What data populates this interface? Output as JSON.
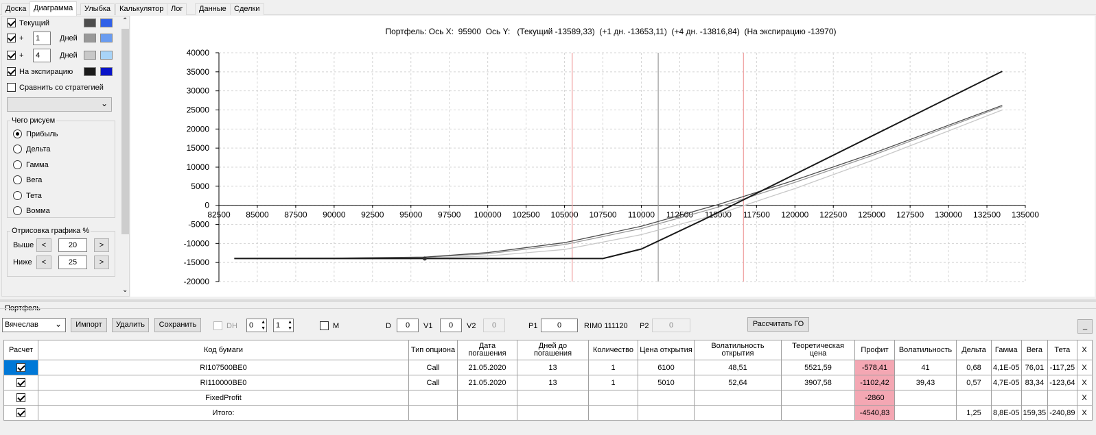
{
  "tabs": [
    "Доска",
    "Диаграмма",
    "Улыбка",
    "Калькулятор",
    "Лог",
    "Данные",
    "Сделки"
  ],
  "active_tab": "Диаграмма",
  "left": {
    "series": [
      {
        "checked": true,
        "prefix": "",
        "days": "",
        "label": "Текущий",
        "colors": [
          "#4d4d4d",
          "#3060e8"
        ]
      },
      {
        "checked": true,
        "prefix": "+",
        "days": "1",
        "label": "Дней",
        "colors": [
          "#999999",
          "#6a9cf0"
        ]
      },
      {
        "checked": true,
        "prefix": "+",
        "days": "4",
        "label": "Дней",
        "colors": [
          "#c8c8c8",
          "#a8d4f8"
        ]
      },
      {
        "checked": true,
        "prefix": "",
        "days": "",
        "label": "На экспирацию",
        "colors": [
          "#1a1a1a",
          "#0a14c8"
        ]
      }
    ],
    "compare_label": "Сравнить со стратегией",
    "compare_checked": false,
    "what_group_title": "Чего рисуем",
    "radios": [
      "Прибыль",
      "Дельта",
      "Гамма",
      "Вега",
      "Тета",
      "Вомма"
    ],
    "radio_selected": "Прибыль",
    "draw_group_title": "Отрисовка графика %",
    "above_label": "Выше",
    "above_value": "20",
    "below_label": "Ниже",
    "below_value": "25"
  },
  "chart": {
    "title": "Портфель: Ось X:  95900  Ось Y:   (Текущий -13589,33)  (+1 дн. -13653,11)  (+4 дн. -13816,84)  (На экспирацию -13970)"
  },
  "chart_data": {
    "type": "line",
    "title": "Портфель: Ось X:  95900  Ось Y:   (Текущий -13589,33)  (+1 дн. -13653,11)  (+4 дн. -13816,84)  (На экспирацию -13970)",
    "xlim": [
      82500,
      135000
    ],
    "ylim": [
      -20000,
      40000
    ],
    "x_ticks": [
      "82500",
      "85000",
      "87500",
      "90000",
      "92500",
      "95000",
      "97500",
      "100000",
      "102500",
      "105000",
      "107500",
      "110000",
      "112500",
      "115000",
      "117500",
      "120000",
      "122500",
      "125000",
      "127500",
      "130000",
      "132500",
      "135000"
    ],
    "y_ticks": [
      "40000",
      "35000",
      "30000",
      "25000",
      "20000",
      "15000",
      "10000",
      "5000",
      "0",
      "-5000",
      "-10000",
      "-15000",
      "-20000"
    ],
    "grid": true,
    "vlines": [
      {
        "x": 105500,
        "color": "#f0a0a0"
      },
      {
        "x": 111100,
        "color": "#999999"
      },
      {
        "x": 116650,
        "color": "#f0a0a0"
      }
    ],
    "marker": {
      "x": 95900,
      "y": -13970
    },
    "series": [
      {
        "name": "Текущий",
        "color": "#4d4d4d",
        "x": [
          83500,
          90000,
          95900,
          100000,
          105000,
          110000,
          115000,
          120000,
          125000,
          130000,
          133500
        ],
        "y": [
          -13900,
          -13850,
          -13589,
          -12400,
          -9800,
          -5500,
          200,
          6600,
          13500,
          21000,
          26200
        ]
      },
      {
        "name": "+1 дн.",
        "color": "#999999",
        "x": [
          83500,
          90000,
          95900,
          100000,
          105000,
          110000,
          115000,
          120000,
          125000,
          130000,
          133500
        ],
        "y": [
          -13920,
          -13890,
          -13653,
          -12700,
          -10300,
          -6100,
          -500,
          6000,
          13000,
          20600,
          25900
        ]
      },
      {
        "name": "+4 дн.",
        "color": "#c8c8c8",
        "x": [
          83500,
          90000,
          95900,
          100000,
          105000,
          110000,
          115000,
          120000,
          125000,
          130000,
          133500
        ],
        "y": [
          -13960,
          -13950,
          -13816,
          -13300,
          -11600,
          -7700,
          -2300,
          4400,
          11700,
          19500,
          25000
        ]
      },
      {
        "name": "На экспирацию",
        "color": "#1a1a1a",
        "x": [
          83500,
          107500,
          110000,
          114000,
          120000,
          125000,
          130000,
          133500
        ],
        "y": [
          -13970,
          -13970,
          -11470,
          -3860,
          8140,
          18140,
          28140,
          35140
        ]
      }
    ]
  },
  "portfolio": {
    "title": "Портфель",
    "user": "Вячеслав",
    "import_label": "Импорт",
    "delete_label": "Удалить",
    "save_label": "Сохранить",
    "dh_label": "DH",
    "spin1": "0",
    "spin2": "1",
    "m_label": "M",
    "d_label": "D",
    "d_value": "0",
    "v1_label": "V1",
    "v1_value": "0",
    "v2_label": "V2",
    "v2_value": "0",
    "p1_label": "P1",
    "p1_value": "0",
    "rim_label": "RIM0 111120",
    "p2_label": "P2",
    "p2_value": "0",
    "calc_go_label": "Рассчитать ГО",
    "minimize_label": "_"
  },
  "table": {
    "headers": [
      "Расчет",
      "Код бумаги",
      "Тип опциона",
      "Дата погашения",
      "Дней до погашения",
      "Количество",
      "Цена открытия",
      "Волатильность открытия",
      "Теоретическая цена",
      "Профит",
      "Волатильность",
      "Дельта",
      "Гамма",
      "Вега",
      "Тета",
      "X"
    ],
    "rows": [
      [
        "",
        "RI107500BE0",
        "Call",
        "21.05.2020",
        "13",
        "1",
        "6100",
        "48,51",
        "5521,59",
        "-578,41",
        "41",
        "0,68",
        "4,1E-05",
        "76,01",
        "-117,25",
        "X"
      ],
      [
        "",
        "RI110000BE0",
        "Call",
        "21.05.2020",
        "13",
        "1",
        "5010",
        "52,64",
        "3907,58",
        "-1102,42",
        "39,43",
        "0,57",
        "4,7E-05",
        "83,34",
        "-123,64",
        "X"
      ],
      [
        "",
        "FixedProfit",
        "",
        "",
        "",
        "",
        "",
        "",
        "",
        "-2860",
        "",
        "",
        "",
        "",
        "",
        "X"
      ],
      [
        "",
        "Итого:",
        "",
        "",
        "",
        "",
        "",
        "",
        "",
        "-4540,83",
        "",
        "1,25",
        "8,8E-05",
        "159,35",
        "-240,89",
        "X"
      ]
    ]
  }
}
